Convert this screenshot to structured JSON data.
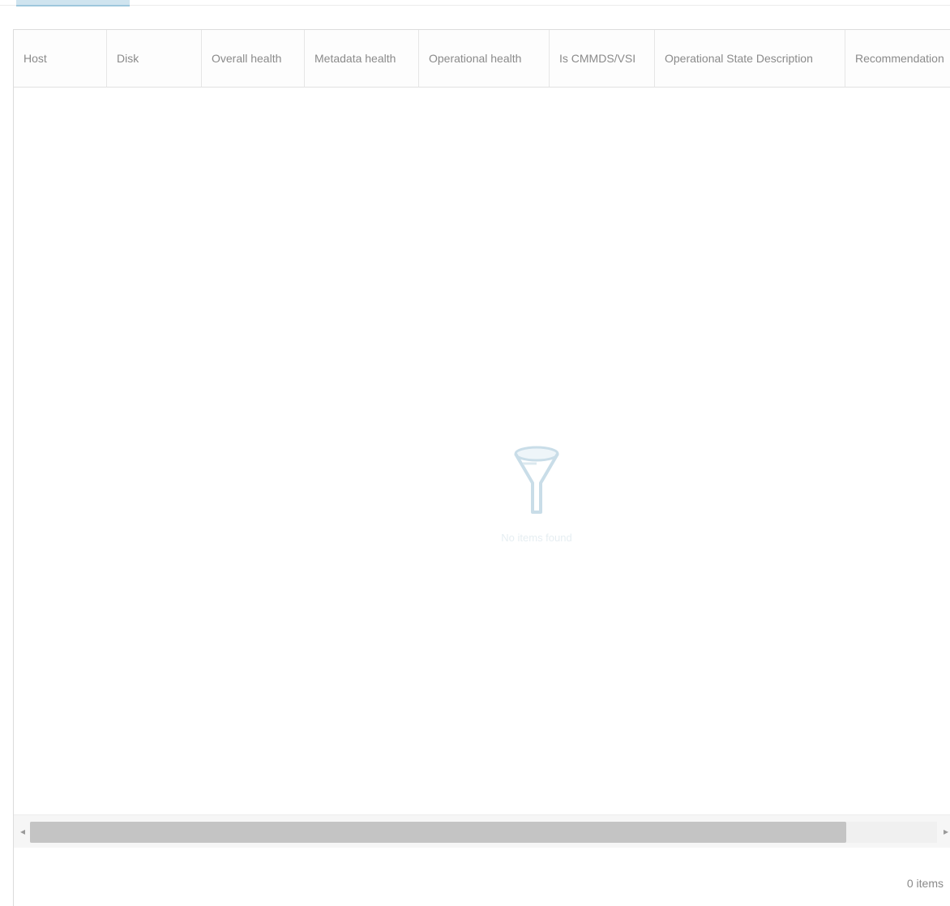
{
  "grid": {
    "columns": [
      "Host",
      "Disk",
      "Overall health",
      "Metadata health",
      "Operational health",
      "Is CMMDS/VSI",
      "Operational State Description",
      "Recommendation"
    ],
    "empty_text": "No items found",
    "scroll_position": 0.0,
    "scroll_visible_fraction": 0.9
  },
  "footer": {
    "count": "0 items"
  }
}
